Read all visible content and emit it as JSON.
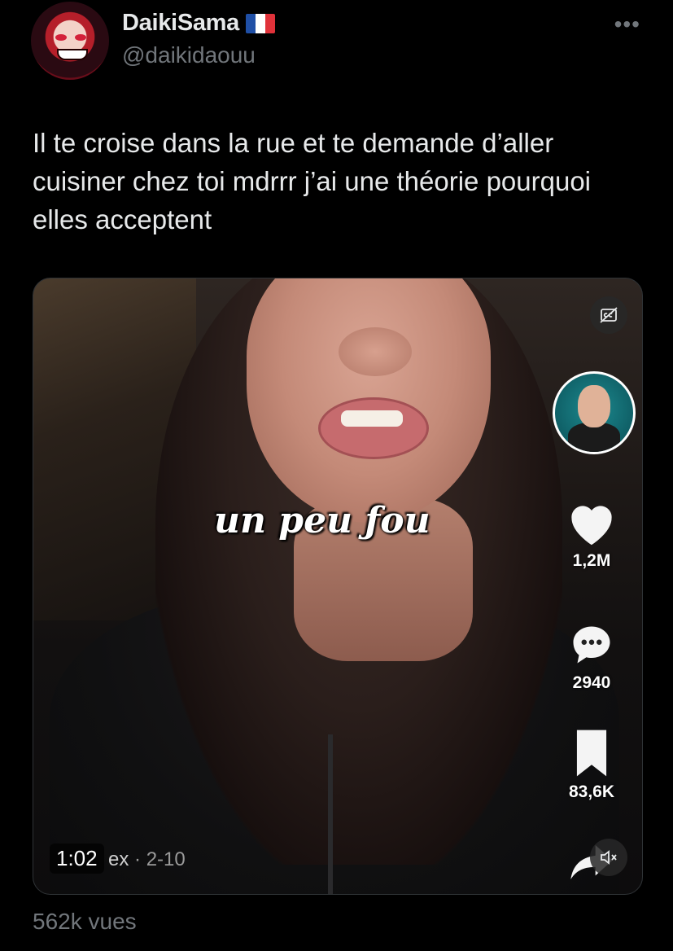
{
  "author": {
    "display_name": "DaikiSama",
    "handle": "@daikidaouu",
    "flag": "france-flag",
    "flag_colors": [
      "#1f4fa6",
      "#ffffff",
      "#e0323a"
    ]
  },
  "more_icon": "more-horizontal-icon",
  "tweet": {
    "text": "Il te croise dans la rue et te demande d’aller cuisiner chez toi mdrrr j’ai une théorie pourquoi elles acceptent"
  },
  "video": {
    "caption": "un peu ƒou",
    "duration": "1:02",
    "watermark_left": "ex",
    "watermark_right": "· 2-10",
    "likes": "1,2M",
    "comments": "2940",
    "saves": "83,6K",
    "icons": {
      "captions": "closed-captions-off-icon",
      "creator": "creator-avatar",
      "like": "heart-icon",
      "comment": "comment-bubble-icon",
      "save": "bookmark-icon",
      "share": "share-arrow-icon",
      "mute": "speaker-muted-icon"
    }
  },
  "views": "562k vues"
}
